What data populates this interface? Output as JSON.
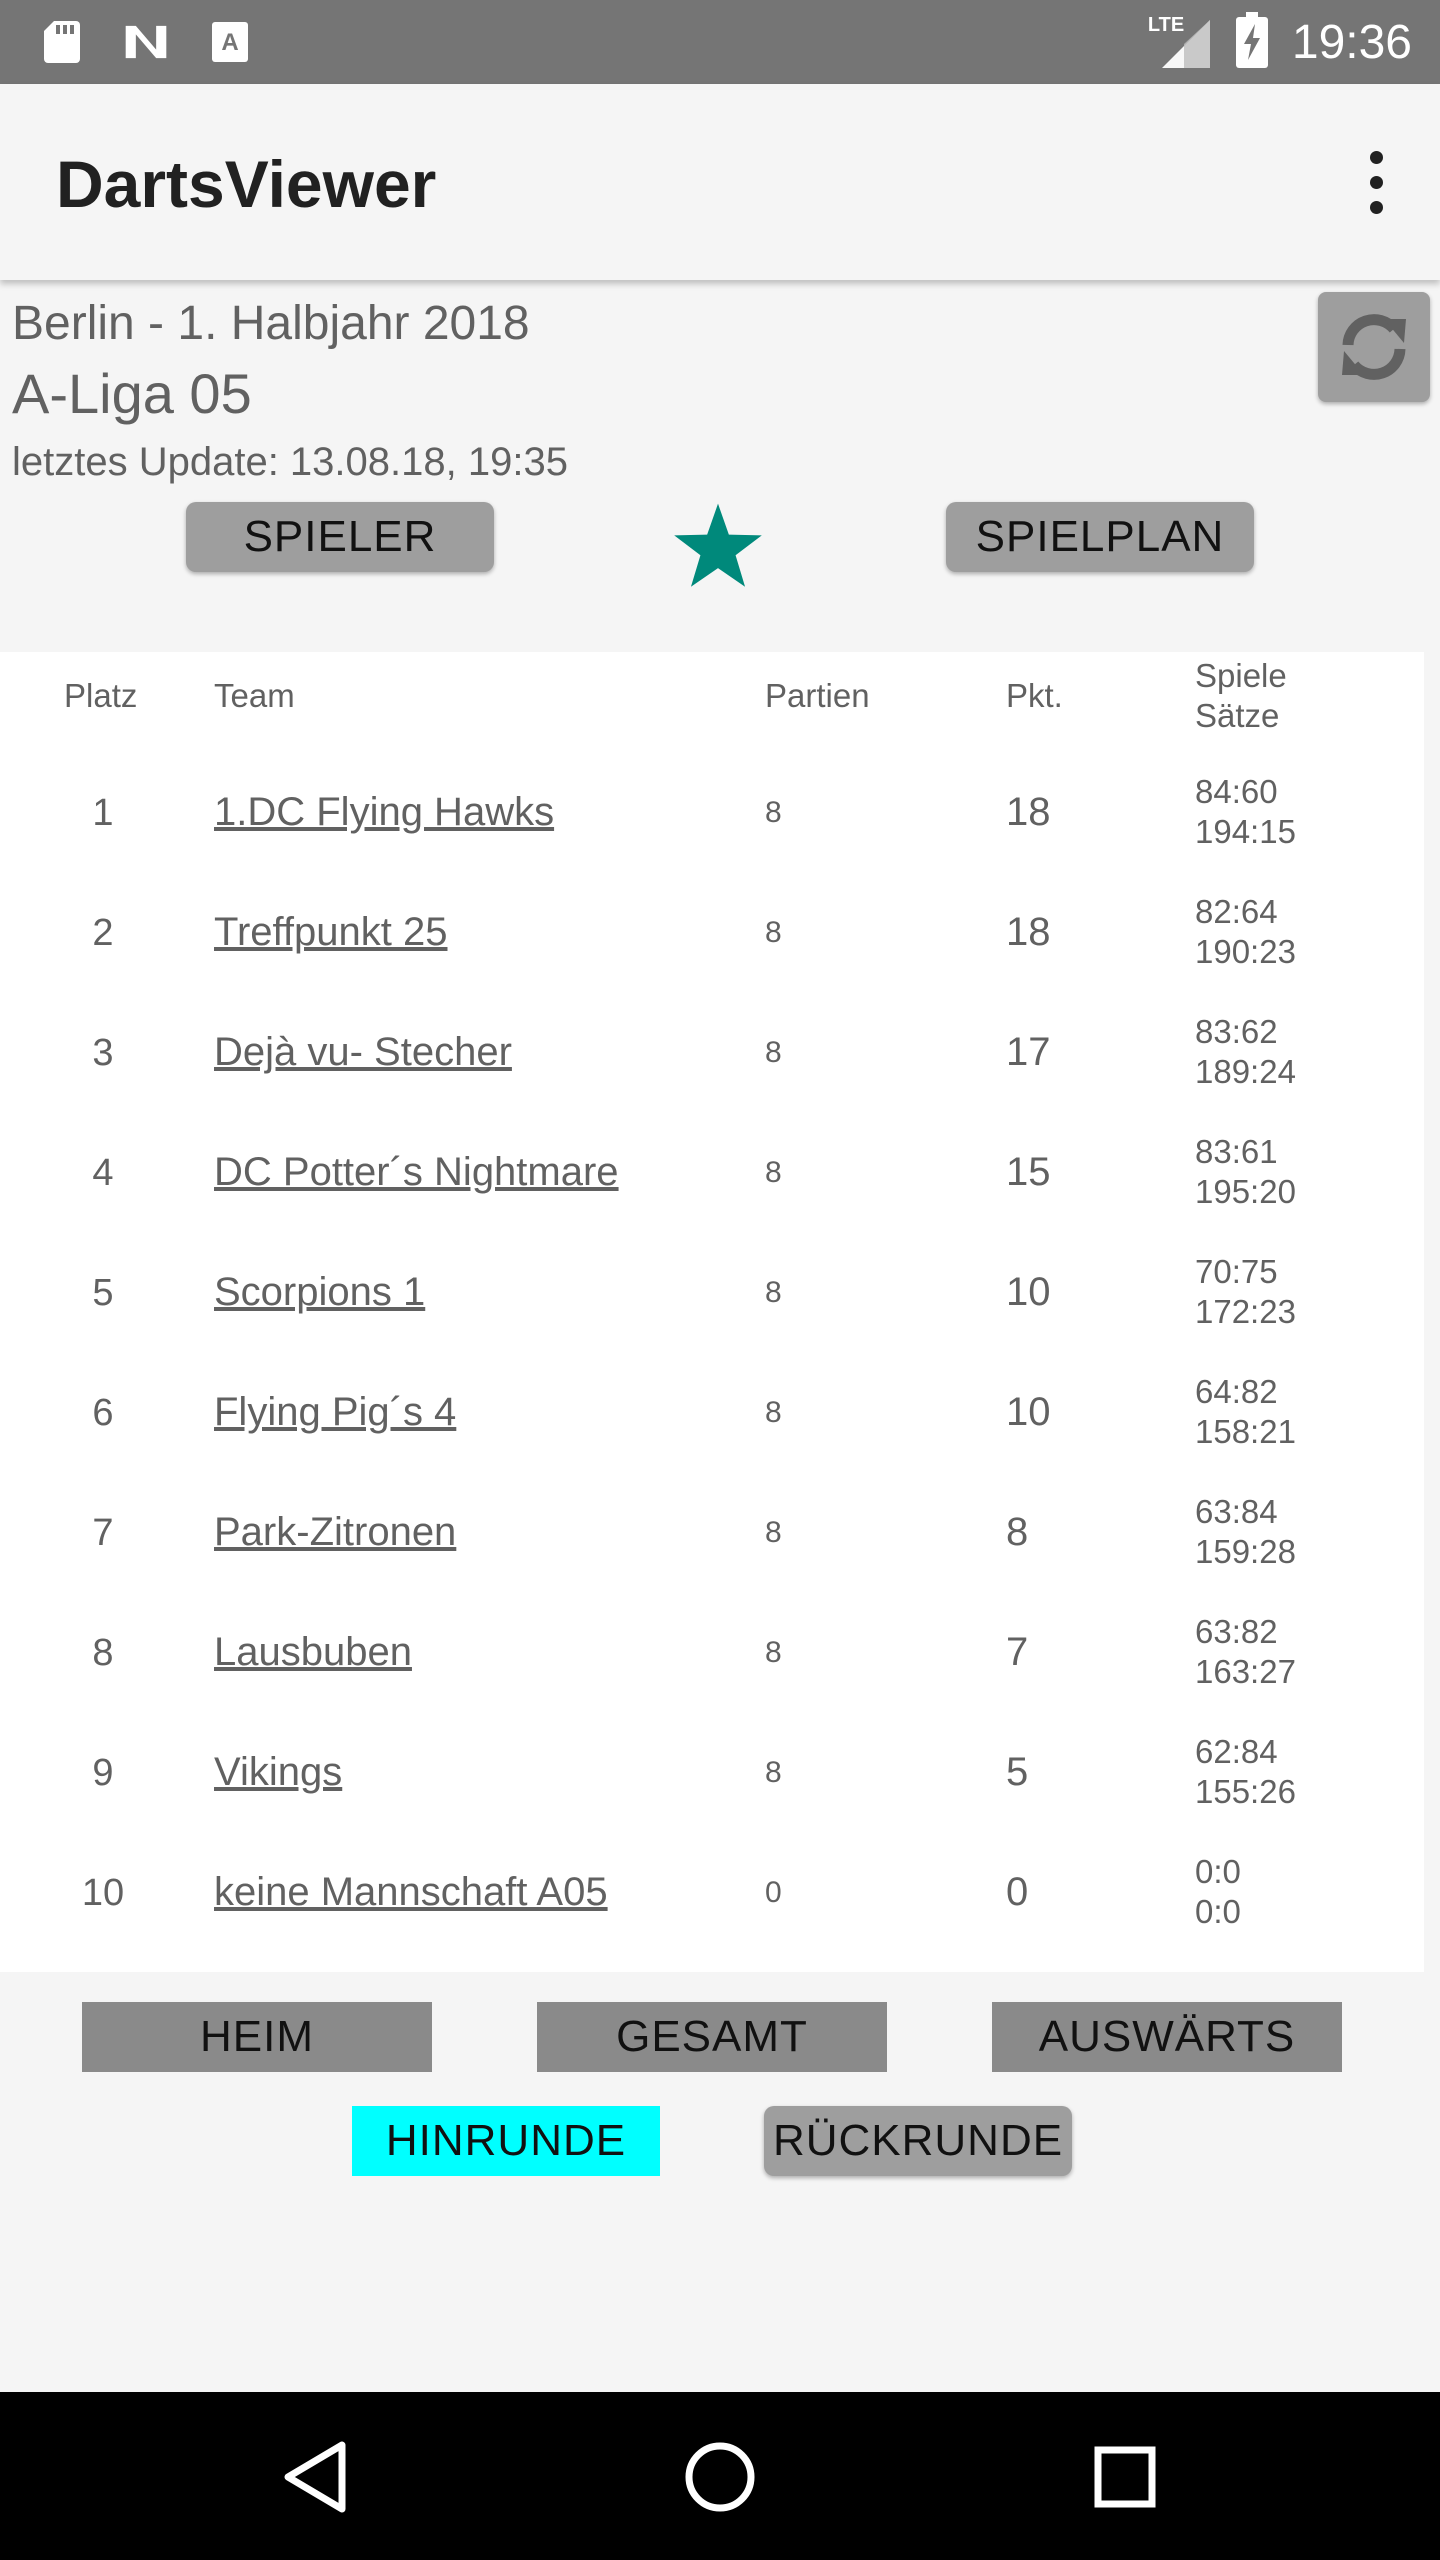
{
  "status_bar": {
    "time": "19:36",
    "network": "LTE",
    "icons": [
      "sd-card-icon",
      "n-notification-icon",
      "a-notification-icon",
      "signal-icon",
      "battery-charging-icon"
    ]
  },
  "app_bar": {
    "title": "DartsViewer",
    "menu_icon": "overflow-menu-icon"
  },
  "header": {
    "season": "Berlin - 1. Halbjahr 2018",
    "league": "A-Liga 05",
    "last_update": "letztes Update: 13.08.18, 19:35",
    "refresh_icon": "refresh-icon"
  },
  "actions": {
    "players_label": "SPIELER",
    "schedule_label": "SPIELPLAN",
    "favorite_icon": "star-icon",
    "favorite_color": "#00897b"
  },
  "table": {
    "headers": {
      "rank": "Platz",
      "team": "Team",
      "games": "Partien",
      "points": "Pkt.",
      "stats_line1": "Spiele",
      "stats_line2": "Sätze"
    },
    "rows": [
      {
        "rank": "1",
        "team": "1.DC Flying Hawks",
        "games": "8",
        "points": "18",
        "spiele": "84:60",
        "saetze": "194:15"
      },
      {
        "rank": "2",
        "team": "Treffpunkt 25",
        "games": "8",
        "points": "18",
        "spiele": "82:64",
        "saetze": "190:23"
      },
      {
        "rank": "3",
        "team": "Dejà vu- Stecher",
        "games": "8",
        "points": "17",
        "spiele": "83:62",
        "saetze": "189:24"
      },
      {
        "rank": "4",
        "team": "DC Potter´s Nightmare",
        "games": "8",
        "points": "15",
        "spiele": "83:61",
        "saetze": "195:20"
      },
      {
        "rank": "5",
        "team": "Scorpions 1",
        "games": "8",
        "points": "10",
        "spiele": "70:75",
        "saetze": "172:23"
      },
      {
        "rank": "6",
        "team": "Flying Pig´s 4",
        "games": "8",
        "points": "10",
        "spiele": "64:82",
        "saetze": "158:21"
      },
      {
        "rank": "7",
        "team": "Park-Zitronen",
        "games": "8",
        "points": "8",
        "spiele": "63:84",
        "saetze": "159:28"
      },
      {
        "rank": "8",
        "team": "Lausbuben",
        "games": "8",
        "points": "7",
        "spiele": "63:82",
        "saetze": "163:27"
      },
      {
        "rank": "9",
        "team": "Vikings",
        "games": "8",
        "points": "5",
        "spiele": "62:84",
        "saetze": "155:26"
      },
      {
        "rank": "10",
        "team": "keine Mannschaft A05",
        "games": "0",
        "points": "0",
        "spiele": "0:0",
        "saetze": "0:0"
      }
    ]
  },
  "filters": {
    "home_label": "HEIM",
    "total_label": "GESAMT",
    "away_label": "AUSWÄRTS",
    "first_half_label": "HINRUNDE",
    "second_half_label": "RÜCKRUNDE",
    "active_color": "#00ffff"
  },
  "nav_bar": {
    "back_icon": "back-triangle-icon",
    "home_icon": "home-circle-icon",
    "recents_icon": "recents-square-icon"
  }
}
